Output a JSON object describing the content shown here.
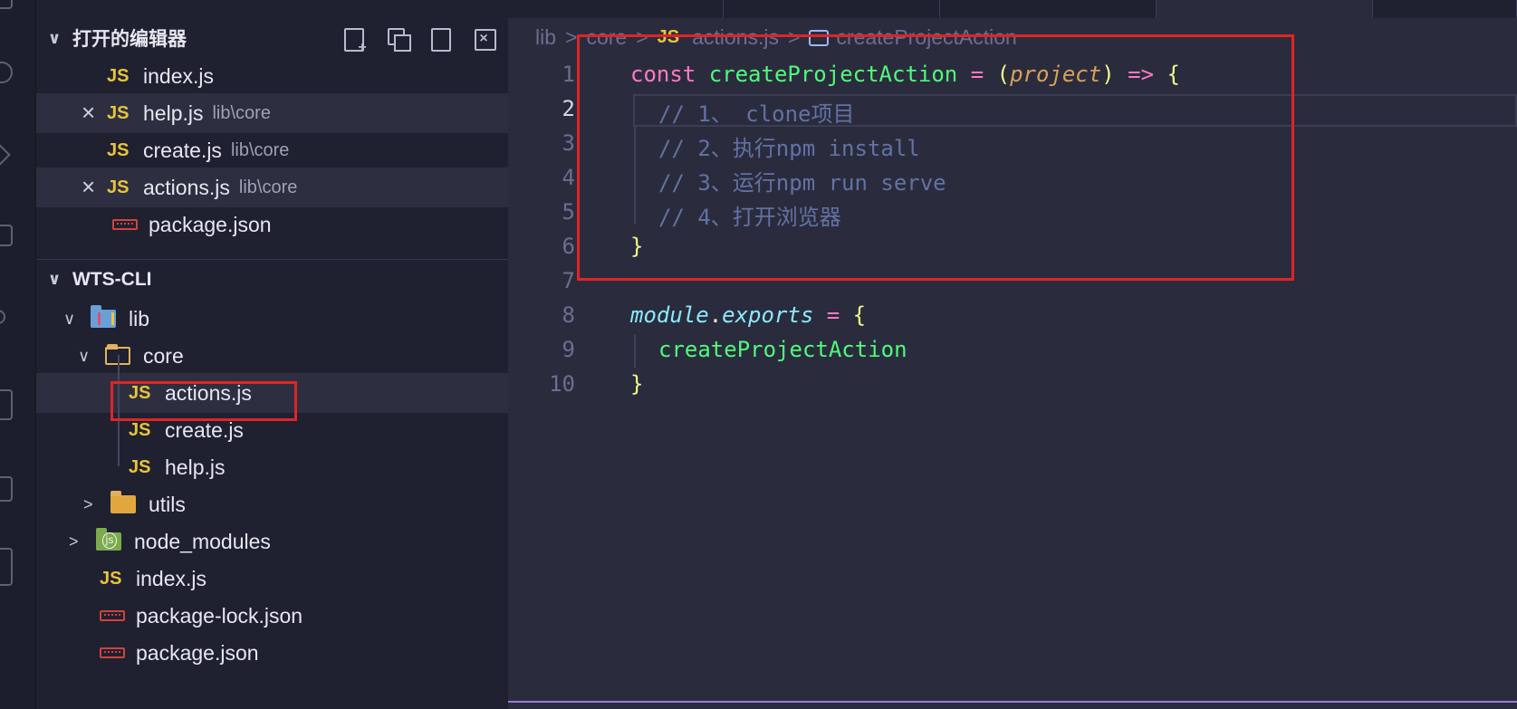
{
  "sidebar": {
    "open_editors": {
      "title": "打开的编辑器",
      "items": [
        {
          "badge": "JS",
          "name": "index.js",
          "path": ""
        },
        {
          "badge": "JS",
          "name": "help.js",
          "path": "lib\\core"
        },
        {
          "badge": "JS",
          "name": "create.js",
          "path": "lib\\core"
        },
        {
          "badge": "JS",
          "name": "actions.js",
          "path": "lib\\core"
        },
        {
          "badge": "",
          "name": "package.json",
          "path": ""
        }
      ]
    },
    "explorer": {
      "title": "WTS-CLI",
      "tree": [
        {
          "name": "lib"
        },
        {
          "name": "core"
        },
        {
          "badge": "JS",
          "name": "actions.js"
        },
        {
          "badge": "JS",
          "name": "create.js"
        },
        {
          "badge": "JS",
          "name": "help.js"
        },
        {
          "name": "utils"
        },
        {
          "name": "node_modules"
        },
        {
          "badge": "JS",
          "name": "index.js"
        },
        {
          "name": "package-lock.json"
        },
        {
          "name": "package.json"
        }
      ]
    }
  },
  "breadcrumb": {
    "parts": [
      "lib",
      "core"
    ],
    "file_badge": "JS",
    "file": "actions.js",
    "symbol": "createProjectAction"
  },
  "editor": {
    "line_numbers": [
      "1",
      "2",
      "3",
      "4",
      "5",
      "6",
      "7",
      "8",
      "9",
      "10"
    ],
    "lines": {
      "l1": {
        "kw": "const",
        "fn": "createProjectAction",
        "eq": "=",
        "p1": "(",
        "param": "project",
        "p2": ")",
        "arrow": "=>",
        "brace": "{"
      },
      "l2": "// 1、 clone项目",
      "l3": "// 2、执行npm install",
      "l4": "// 3、运行npm run serve",
      "l5": "// 4、打开浏览器",
      "l6": "}",
      "l8": {
        "module": "module",
        "dot": ".",
        "exports": "exports",
        "eq": "=",
        "brace": "{"
      },
      "l9": "createProjectAction",
      "l10": "}"
    }
  },
  "colors": {
    "highlight_box": "#e02424",
    "accent": "#9b7bd8"
  }
}
